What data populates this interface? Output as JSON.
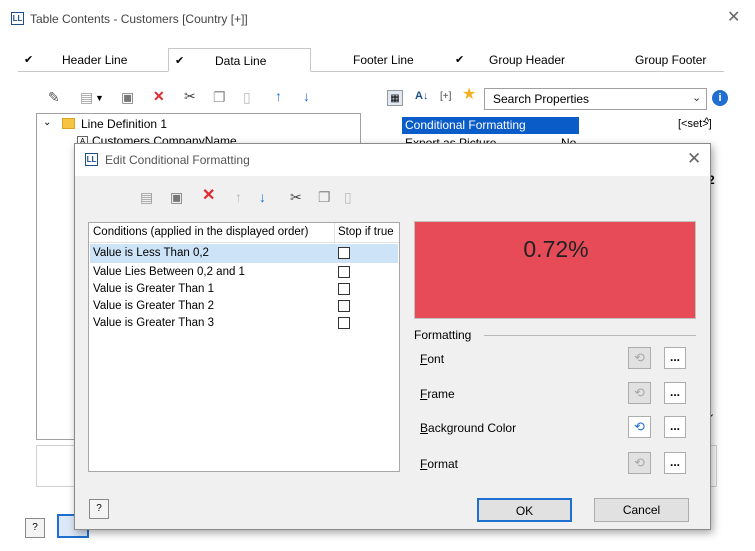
{
  "window": {
    "title": "Table Contents - Customers [Country [+]]",
    "logo_text": "LL",
    "close_glyph": "✕"
  },
  "tabs": [
    {
      "label": "Header Line",
      "checked": true,
      "active": false
    },
    {
      "label": "Data Line",
      "checked": true,
      "active": true
    },
    {
      "label": "Footer Line",
      "checked": false,
      "active": false
    },
    {
      "label": "Group Header",
      "checked": true,
      "active": false
    },
    {
      "label": "Group Footer",
      "checked": false,
      "active": false
    }
  ],
  "tree": {
    "items": [
      {
        "label": "Line Definition  1",
        "type": "folder",
        "expanded": true
      },
      {
        "label": "Customers.CompanyName",
        "type": "field"
      }
    ]
  },
  "properties": {
    "search_placeholder": "Search Properties",
    "rows": [
      {
        "name": "Conditional Formatting",
        "value": "[<set>]",
        "selected": true
      },
      {
        "name": "Export as Picture",
        "value": "No",
        "selected": false
      }
    ],
    "partial_value": "2"
  },
  "dialog": {
    "title": "Edit Conditional Formatting",
    "logo_text": "LL",
    "close_glyph": "✕",
    "columns": {
      "conditions": "Conditions (applied in the displayed order)",
      "stop": "Stop if true"
    },
    "conditions": [
      {
        "label": "Value is Less Than 0,2",
        "stop": false,
        "selected": true
      },
      {
        "label": "Value Lies Between 0,2 and 1",
        "stop": false,
        "selected": false
      },
      {
        "label": "Value is Greater Than 1",
        "stop": false,
        "selected": false
      },
      {
        "label": "Value is Greater Than 2",
        "stop": false,
        "selected": false
      },
      {
        "label": "Value is Greater Than 3",
        "stop": false,
        "selected": false
      }
    ],
    "preview": {
      "value": "0.72%",
      "background": "#e74b58"
    },
    "formatting": {
      "group_label": "Formatting",
      "items": [
        {
          "label": "Font",
          "accel": "F",
          "rest": "ont",
          "undo_active": false
        },
        {
          "label": "Frame",
          "accel": "F",
          "rest": "rame",
          "undo_active": false
        },
        {
          "label": "Background Color",
          "accel": "B",
          "rest": "ackground Color",
          "undo_active": true
        },
        {
          "label": "Format",
          "accel": "F",
          "rest": "ormat",
          "undo_active": false
        }
      ],
      "dots": "..."
    },
    "ok_label": "OK",
    "cancel_label": "Cancel"
  },
  "colors": {
    "selection": "#0a5cc9",
    "accent": "#1e6fd0",
    "delete": "#e0282e"
  }
}
